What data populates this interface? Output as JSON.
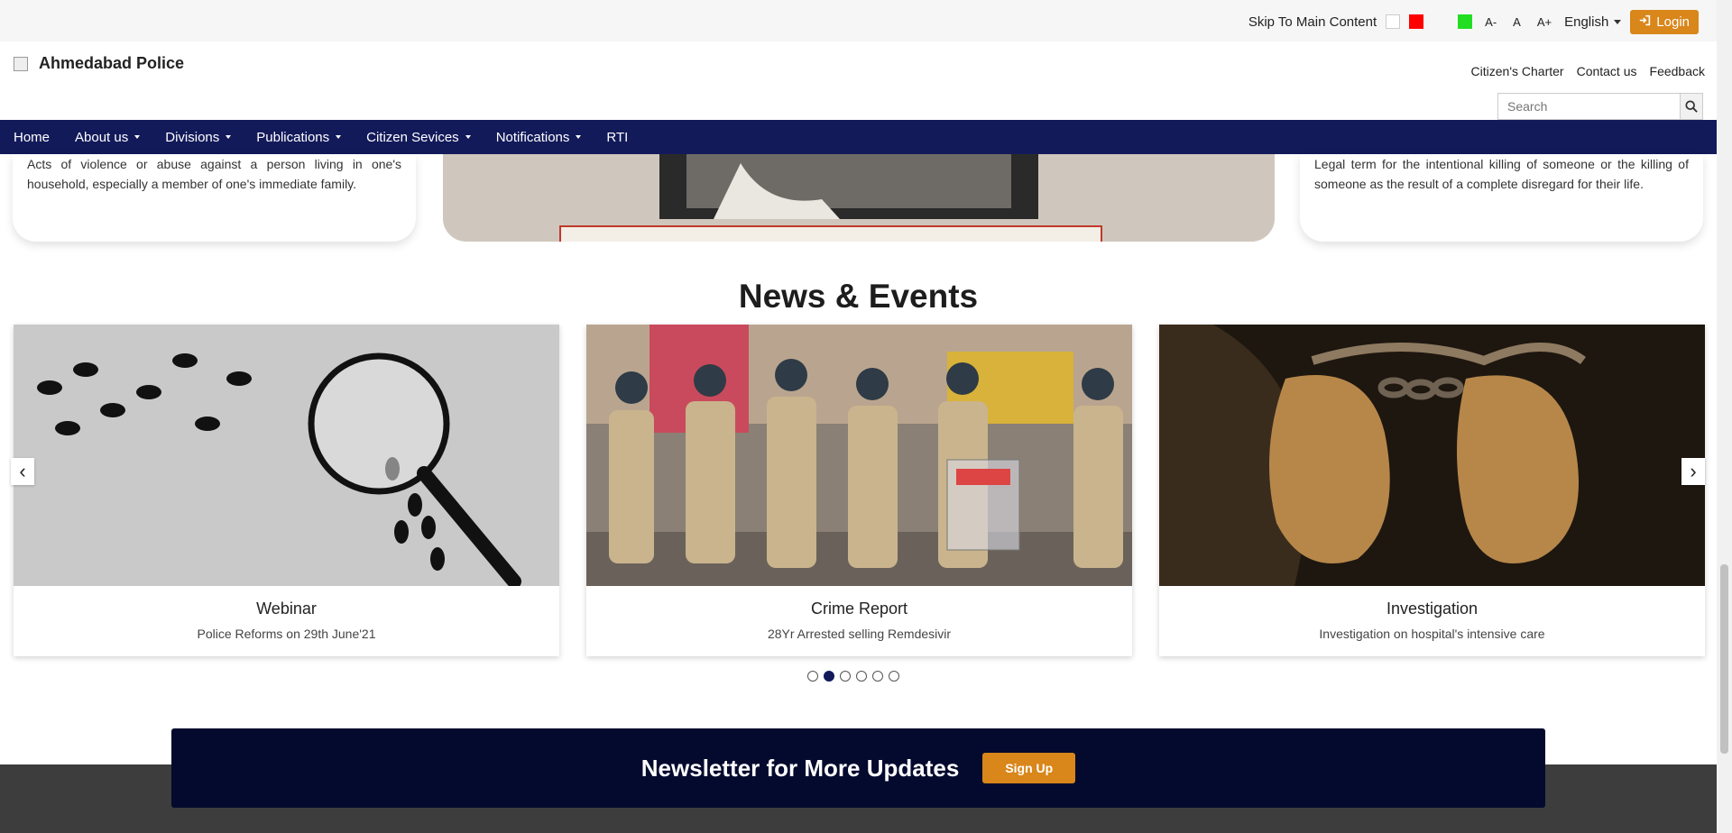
{
  "topbar": {
    "skip_link": "Skip To Main Content",
    "font_controls": [
      "A-",
      "A",
      "A+"
    ],
    "language": "English",
    "login_label": "Login",
    "colors": {
      "swatch_white": "#ffffff",
      "swatch_red": "#ff0000",
      "swatch_green": "#22dd22"
    }
  },
  "header": {
    "site_title": "Ahmedabad Police",
    "links": [
      "Citizen's Charter",
      "Contact us",
      "Feedback"
    ],
    "search_placeholder": "Search"
  },
  "nav": {
    "items": [
      {
        "label": "Home",
        "dropdown": false
      },
      {
        "label": "About us",
        "dropdown": true
      },
      {
        "label": "Divisions",
        "dropdown": true
      },
      {
        "label": "Publications",
        "dropdown": true
      },
      {
        "label": "Citizen Sevices",
        "dropdown": true
      },
      {
        "label": "Notifications",
        "dropdown": true
      },
      {
        "label": "RTI",
        "dropdown": false
      }
    ],
    "color": "#131a5a"
  },
  "crime_cards": {
    "left_text": "Acts of violence or abuse against a person living in one's household, especially a member of one's immediate family.",
    "right_text": "Legal term for the intentional killing of someone or the killing of someone as the result of a complete disregard for their life."
  },
  "news": {
    "title": "News & Events",
    "cards": [
      {
        "title": "Webinar",
        "subtitle": "Police Reforms on 29th June'21"
      },
      {
        "title": "Crime Report",
        "subtitle": "28Yr Arrested selling Remdesivir"
      },
      {
        "title": "Investigation",
        "subtitle": "Investigation on hospital's intensive care"
      }
    ],
    "dots_total": 6,
    "dots_active_index": 1
  },
  "newsletter": {
    "text": "Newsletter for More Updates",
    "button_label": "Sign Up",
    "accent": "#d9861a"
  }
}
